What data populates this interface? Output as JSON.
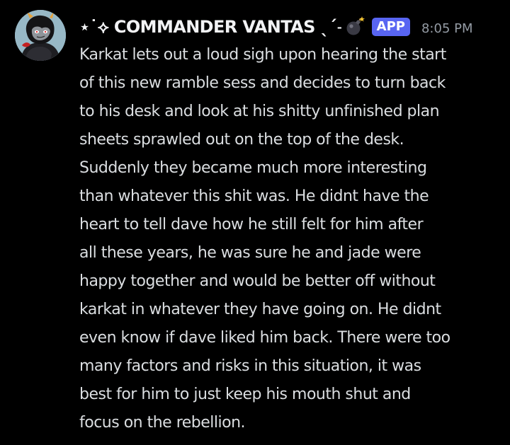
{
  "message": {
    "author": {
      "display_name": "⋆˙⟡ COMMANDER VANTAS ˎˊ˗",
      "name_icon": "bomb-icon",
      "badge": "APP",
      "avatar_icon": "troll-character-avatar"
    },
    "timestamp": "8:05 PM",
    "content_lines": [
      "Karkat lets out a loud sigh upon hearing the start",
      "of this new ramble sess and decides to turn back",
      "to his desk and look at his shitty unfinished plan",
      "sheets sprawled out on the top of the desk.",
      "Suddenly they became much more interesting",
      "than whatever this shit was. He didnt have the",
      "heart to tell dave how he still felt for him after",
      "all these years, he was sure he and jade were",
      "happy together and would be better off without",
      "karkat in whatever they have going on. He didnt",
      "even know if dave liked him back. There were too",
      "many factors and risks in this situation, it was",
      "best for him to just keep his mouth shut and",
      "focus on the rebellion."
    ]
  },
  "colors": {
    "background": "#000000",
    "username": "#f2f3f5",
    "message_text": "#dbdee1",
    "timestamp": "#949ba4",
    "app_badge": "#5865f2",
    "avatar_background": "#97b8c6"
  }
}
